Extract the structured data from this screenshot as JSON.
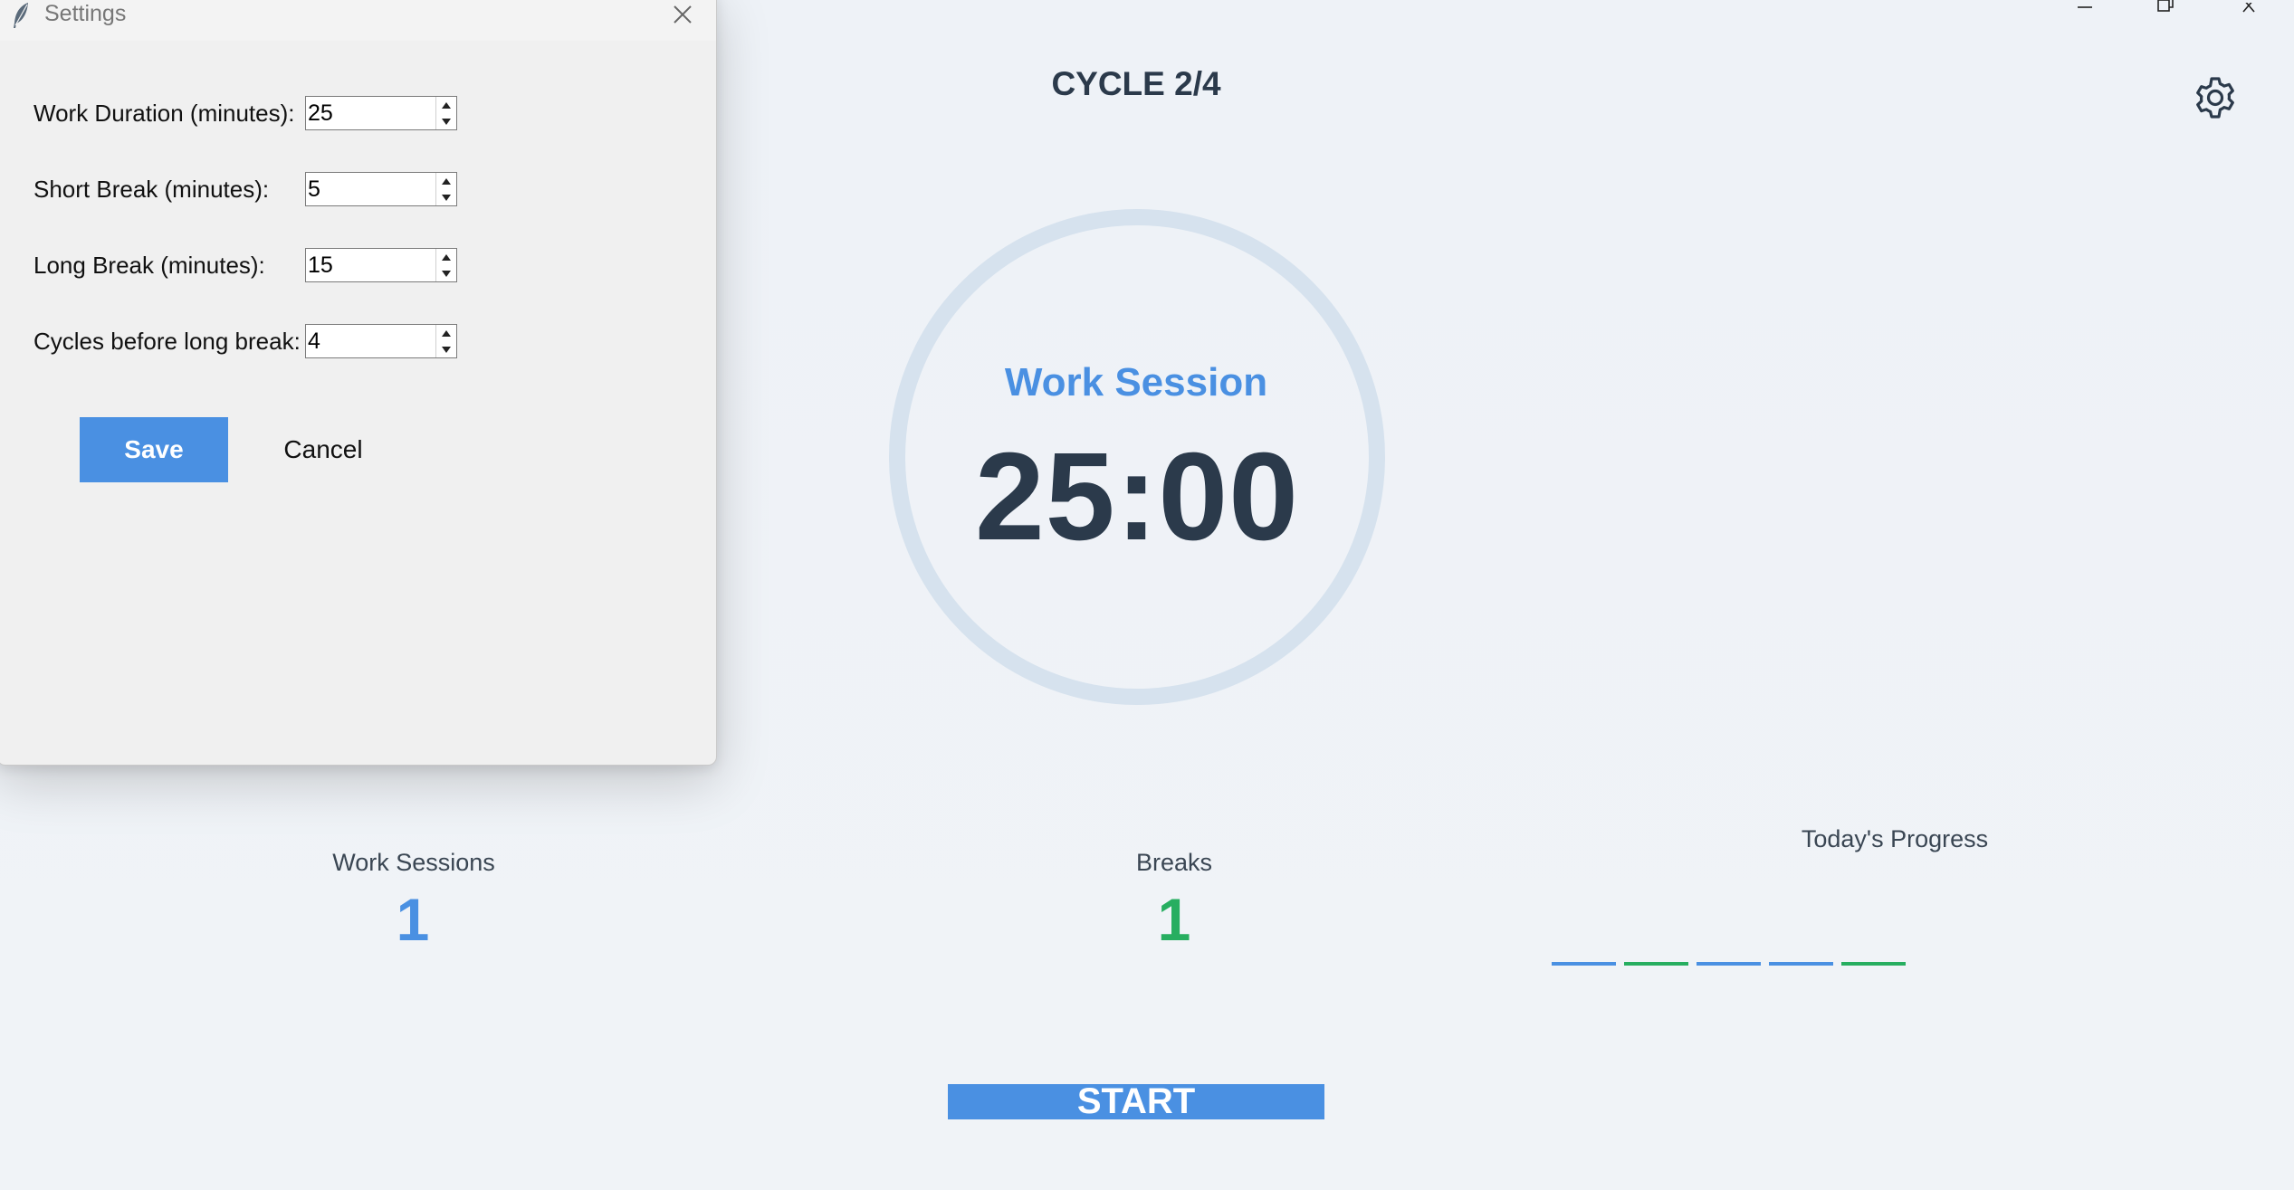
{
  "main": {
    "cycle_label": "CYCLE 2/4",
    "session_label": "Work Session",
    "timer": "25:00",
    "start_label": "START"
  },
  "stats": {
    "work_sessions_label": "Work Sessions",
    "work_sessions_value": "1",
    "breaks_label": "Breaks",
    "breaks_value": "1",
    "progress_label": "Today's Progress",
    "progress_segments": [
      {
        "type": "work",
        "color": "#4a90e2"
      },
      {
        "type": "break",
        "color": "#27ae60"
      },
      {
        "type": "work",
        "color": "#4a90e2"
      },
      {
        "type": "work",
        "color": "#4a90e2"
      },
      {
        "type": "break",
        "color": "#27ae60"
      }
    ]
  },
  "settings_dialog": {
    "title": "Settings",
    "fields": [
      {
        "label": "Work Duration (minutes):",
        "value": "25"
      },
      {
        "label": "Short Break (minutes):",
        "value": "5"
      },
      {
        "label": "Long Break (minutes):",
        "value": "15"
      },
      {
        "label": "Cycles before long break:",
        "value": "4"
      }
    ],
    "save_label": "Save",
    "cancel_label": "Cancel"
  },
  "colors": {
    "accent_blue": "#4a90e2",
    "accent_green": "#27ae60",
    "text_dark": "#2b3a4b",
    "ring": "#d6e2ee",
    "background": "#f0f3f7"
  },
  "icons": {
    "settings": "gear-icon",
    "dialog_app": "feather-icon",
    "dialog_close": "close-icon",
    "window_minimize": "minimize-icon",
    "window_maximize": "restore-icon",
    "window_close": "close-icon"
  }
}
